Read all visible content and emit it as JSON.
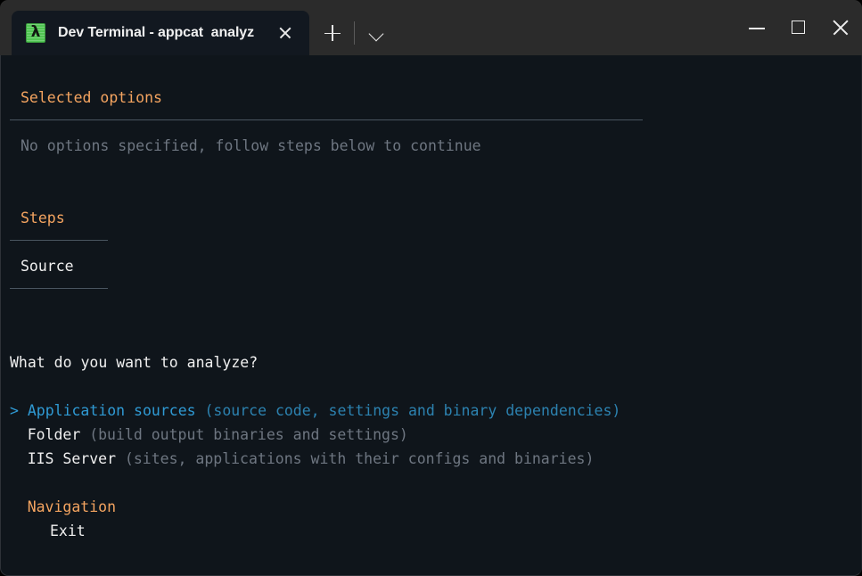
{
  "window": {
    "title": "Dev Terminal - appcat  analyz",
    "icon": "lambda-green-icon",
    "controls": {
      "minimize": "minimize-icon",
      "maximize": "maximize-icon",
      "close": "close-icon"
    },
    "tab_actions": {
      "new_tab": "plus-icon",
      "dropdown": "chevron-down-icon"
    },
    "tab_close": "close-icon"
  },
  "colors": {
    "accent_orange": "#f4a460",
    "selected_blue": "#2f9ad4",
    "dim_gray": "#6e7681",
    "terminal_bg": "#0f151b",
    "titlebar_bg": "#2b2b2b",
    "tab_bg": "#121820",
    "icon_green": "#51c653"
  },
  "terminal": {
    "selected_options": {
      "heading": "Selected options",
      "message": "No options specified, follow steps below to continue"
    },
    "steps": {
      "heading": "Steps",
      "current": "Source"
    },
    "prompt": {
      "question": "What do you want to analyze?",
      "cursor": ">",
      "options": [
        {
          "label": "Application sources",
          "description": "(source code, settings and binary dependencies)",
          "selected": true
        },
        {
          "label": "Folder",
          "description": "(build output binaries and settings)",
          "selected": false
        },
        {
          "label": "IIS Server",
          "description": "(sites, applications with their configs and binaries)",
          "selected": false
        }
      ]
    },
    "navigation": {
      "heading": "Navigation",
      "items": [
        {
          "label": "Exit"
        }
      ]
    }
  }
}
